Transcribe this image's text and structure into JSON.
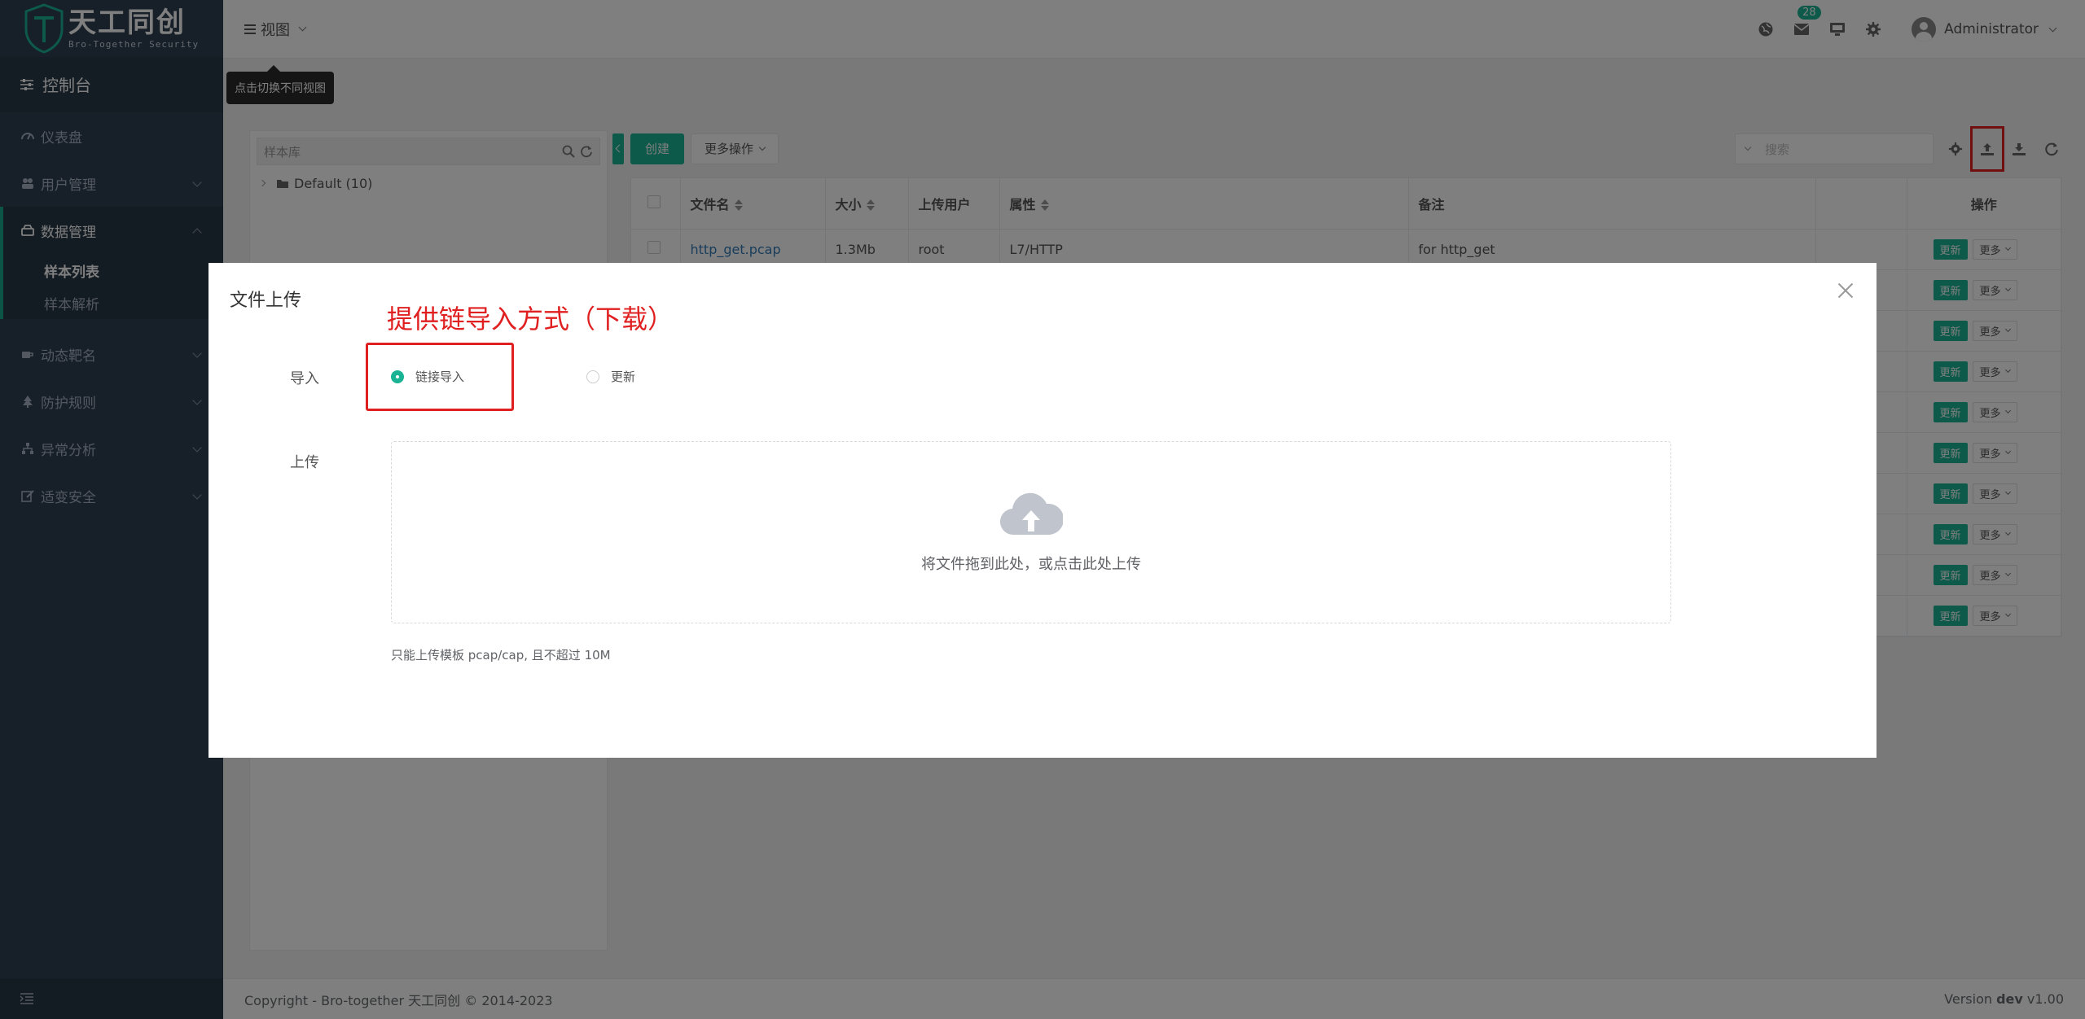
{
  "brand": {
    "name_cn": "天工同创",
    "name_en": "Bro-Together Security"
  },
  "sidebar": {
    "console_label": "控制台",
    "items": [
      {
        "label": "仪表盘",
        "icon": "dashboard-icon"
      },
      {
        "label": "用户管理",
        "icon": "users-icon"
      },
      {
        "label": "数据管理",
        "icon": "hdd-icon",
        "open": true,
        "children": [
          {
            "label": "样本列表",
            "active": true
          },
          {
            "label": "样本解析"
          }
        ]
      },
      {
        "label": "动态靶名",
        "icon": "coffee-icon"
      },
      {
        "label": "防护规则",
        "icon": "tree-icon"
      },
      {
        "label": "异常分析",
        "icon": "sitemap-icon"
      },
      {
        "label": "适变安全",
        "icon": "edit-icon"
      }
    ]
  },
  "header": {
    "view_label": "视图",
    "mail_badge": "28",
    "user_name": "Administrator"
  },
  "tooltip": {
    "text": "点击切换不同视图"
  },
  "tree": {
    "search_placeholder": "样本库",
    "nodes": [
      {
        "label": "Default (10)"
      }
    ]
  },
  "toolbar": {
    "create_label": "创建",
    "more_label": "更多操作",
    "search_placeholder": "搜索"
  },
  "table": {
    "columns": [
      "文件名",
      "大小",
      "上传用户",
      "属性",
      "备注",
      "",
      "操作"
    ],
    "rows": [
      {
        "filename": "http_get.pcap",
        "size": "1.3Mb",
        "user": "root",
        "attr": "L7/HTTP",
        "note": "for http_get"
      }
    ],
    "row_count": 10,
    "update_label": "更新",
    "more_label": "更多"
  },
  "modal": {
    "title": "文件上传",
    "annotation": "提供链导入方式（下载）",
    "import_label": "导入",
    "upload_label": "上传",
    "option_link": "链接导入",
    "option_update": "更新",
    "dropzone_text": "将文件拖到此处，或点击此处上传",
    "tip": "只能上传模板 pcap/cap, 且不超过 10M"
  },
  "footer": {
    "copyright": "Copyright - Bro-together 天工同创 © 2014-2023",
    "version_prefix": "Version ",
    "version_value": "dev",
    "version_number": " v1.00"
  },
  "colors": {
    "accent": "#1ab394",
    "sidebar_bg": "#2f4050",
    "annotation_red": "#e02020"
  }
}
